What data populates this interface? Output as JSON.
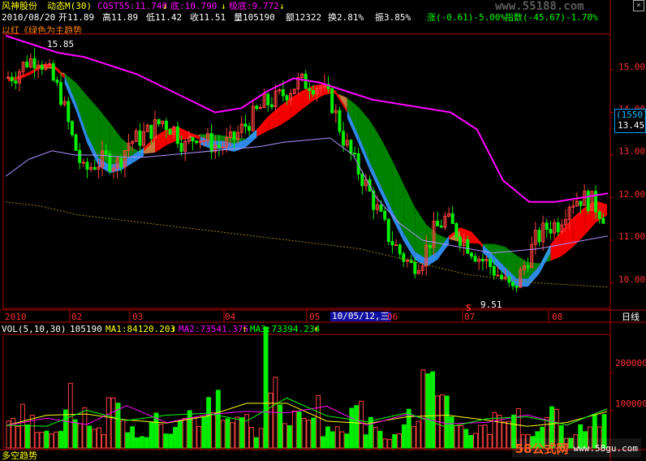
{
  "header": {
    "stock_name": "风神股份",
    "indicator": "动态M(30)",
    "cost_label": "COST55:11.740",
    "cost_arrow": "↓",
    "bottom_label": "底:10.790",
    "bottom_arrow": "↓",
    "extreme_label": "极底:9.772",
    "extreme_arrow": "↓",
    "date": "2010/08/20",
    "open": "开11.89",
    "high": "高11.89",
    "low": "低11.42",
    "close": "收11.51",
    "volume": "量105190",
    "amount": "额12322",
    "turnover": "换2.81%",
    "amplitude": "振3.85%",
    "change": "涨(-0.61)-5.00%",
    "index_partial": "指数(-45.67)-1.70%",
    "watermark_top": "www.55188.com",
    "hint": "以红《绿色为主趋势"
  },
  "price_axis": {
    "labels": [
      "15.00",
      "14.00",
      "13.00",
      "12.00",
      "11.00",
      "10.00"
    ],
    "box_code": "(1550)",
    "box_price": "13.45"
  },
  "annotations": {
    "high_mark": "15.85",
    "low_mark": "9.51",
    "s_mark": "S"
  },
  "time_axis": {
    "labels": [
      "2010",
      "02",
      "03",
      "04",
      "05",
      "06",
      "07",
      "08"
    ],
    "cursor_label": "10/05/12,三",
    "period": "日线"
  },
  "volume_panel": {
    "title": "VOL(5,10,30)",
    "value": "105190",
    "ma1": "MA1:84120.203",
    "ma1_arrow": "↑",
    "ma2": "MA2:73541.375",
    "ma2_arrow": "↑",
    "ma3": "MA3:73394.234",
    "ma3_arrow": "↑",
    "axis_labels": [
      "200000",
      "100000"
    ]
  },
  "footer_partial": {
    "bottom_label": "多空趋势"
  },
  "watermark": {
    "site": "58公式网",
    "url": "www.58gu.com"
  },
  "colors": {
    "background": "#000000",
    "frame": "#b00000",
    "up": "#ff4040",
    "down": "#00ee00",
    "ma_long": "#ff00ff",
    "ribbon_green": "#008800",
    "ribbon_blue": "#3399ff",
    "ribbon_red": "#ff0000",
    "ribbon_orange": "#d08040"
  },
  "chart_data": {
    "type": "candlestick",
    "ylim": [
      9.4,
      15.8
    ],
    "ylim_volume": [
      0,
      280000
    ],
    "x_months": [
      "2010",
      "02",
      "03",
      "04",
      "05",
      "06",
      "07",
      "08"
    ],
    "close_path": [
      14.8,
      14.9,
      15.2,
      15.3,
      14.9,
      14.4,
      13.4,
      12.6,
      12.8,
      12.9,
      12.8,
      13.3,
      13.4,
      13.6,
      13.8,
      13.6,
      13.2,
      13.5,
      13.3,
      13.2,
      13.3,
      13.6,
      13.9,
      14.2,
      14.3,
      14.5,
      14.7,
      14.7,
      14.6,
      14.2,
      13.4,
      12.8,
      12.3,
      11.7,
      11.1,
      10.7,
      10.4,
      10.6,
      11.2,
      11.5,
      11.2,
      10.9,
      10.6,
      10.4,
      10.1,
      9.8,
      10.4,
      11.0,
      11.3,
      11.4,
      11.9,
      12.0,
      11.9,
      11.6
    ],
    "ma_long": [
      15.8,
      15.6,
      15.4,
      15.3,
      15.1,
      14.9,
      14.6,
      14.3,
      14.0,
      14.1,
      14.5,
      14.8,
      14.7,
      14.5,
      14.3,
      14.2,
      14.1,
      14.0,
      13.6,
      12.4,
      11.9,
      11.9,
      12.0,
      12.1
    ],
    "volume": [
      80000,
      120000,
      40000,
      60000,
      150000,
      90000,
      50000,
      130000,
      70000,
      45000,
      110000,
      60000,
      85000,
      95000,
      160000,
      70000,
      80000,
      55000,
      270000,
      100000,
      90000,
      130000,
      60000,
      50000,
      180000,
      70000,
      40000,
      65000,
      90000,
      200000,
      120000,
      80000,
      55000,
      60000,
      110000,
      100000,
      45000,
      70000,
      95000,
      50000,
      60000,
      105190
    ],
    "ma_volume": [
      60000,
      70000,
      80000,
      90000,
      85000,
      80000,
      95000,
      110000,
      90000,
      80000,
      75000,
      70000,
      72000,
      75000,
      80000,
      84120
    ]
  }
}
